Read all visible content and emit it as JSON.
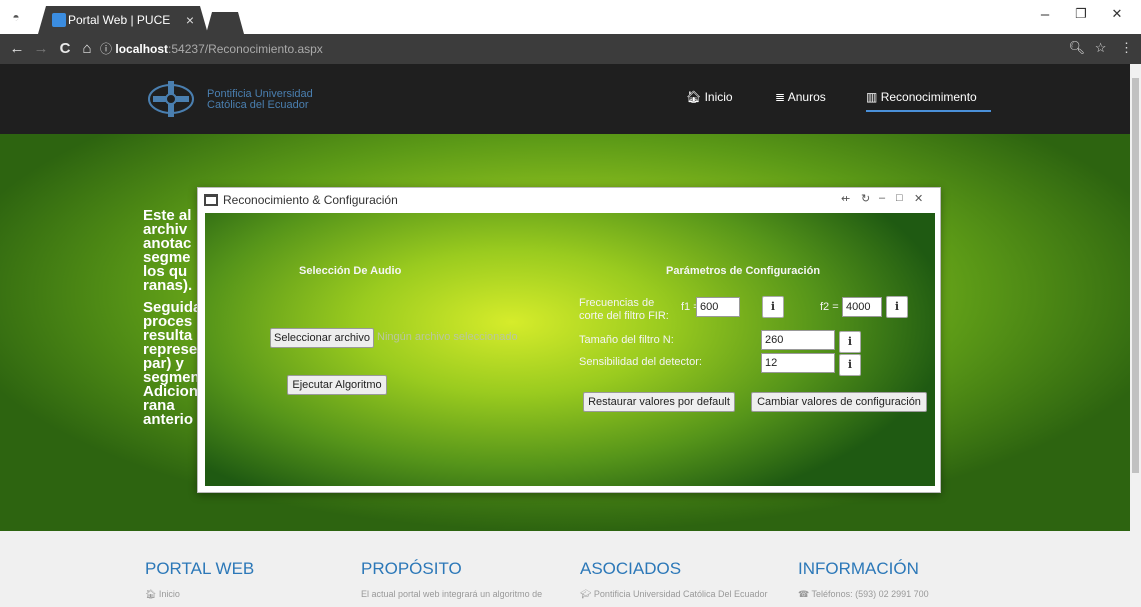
{
  "browser": {
    "incognito_icon": "incognito-icon",
    "tab_title": "Portal Web | PUCE",
    "tab_close": "×",
    "url_host": "localhost",
    "url_rest": ":54237/Reconocimiento.aspx",
    "info_glyph": "ⓘ",
    "back": "←",
    "forward": "→",
    "reload": "C",
    "home": "⌂",
    "zoom_icon": "🔍︎",
    "star": "☆",
    "menu": "⋮",
    "minimize": "–",
    "maximize": "❐",
    "close": "✕"
  },
  "nav": {
    "logo_line1": "Pontificia Universidad",
    "logo_line2": "Católica del Ecuador",
    "items": [
      {
        "icon": "home-icon",
        "glyph": "🏠︎",
        "label": "Inicio"
      },
      {
        "icon": "database-icon",
        "glyph": "≣",
        "label": "Anuros"
      },
      {
        "icon": "bar-chart-icon",
        "glyph": "▥",
        "label": "Reconocimimento"
      }
    ]
  },
  "hero": {
    "para1": "Este al archiv anotac segme los qu ranas).",
    "para2": "Seguida proces resulta represe par) y segmen Adicion rana anterio"
  },
  "modal": {
    "title": "Reconocimiento & Configuración",
    "controls": [
      "⇷",
      "↻",
      "–",
      "□",
      "✕"
    ],
    "audio_title": "Selección De Audio",
    "select_file": "Seleccionar archivo",
    "no_file": "Ningún archivo seleccionado",
    "run": "Ejecutar Algoritmo",
    "config_title": "Parámetros de Configuración",
    "freq_label": "Frecuencias de corte del filtro FIR:",
    "f1_label": "f1 =",
    "f1_value": "600",
    "f2_label": "f2 =",
    "f2_value": "4000",
    "n_label": "Tamaño del filtro N:",
    "n_value": "260",
    "sens_label": "Sensibilidad del detector:",
    "sens_value": "12",
    "info_glyph": "i",
    "restore": "Restaurar valores por default",
    "change": "Cambiar valores de configuración"
  },
  "footer": {
    "cols": [
      {
        "title": "PORTAL WEB",
        "text": "🏠︎ Inicio"
      },
      {
        "title": "PROPÓSITO",
        "text": "El actual portal web integrará un algoritmo de"
      },
      {
        "title": "ASOCIADOS",
        "text": "🎓︎ Pontificia Universidad Católica Del Ecuador"
      },
      {
        "title": "INFORMACIÓN",
        "text": "☎︎ Teléfonos: (593) 02 2991 700"
      }
    ]
  }
}
